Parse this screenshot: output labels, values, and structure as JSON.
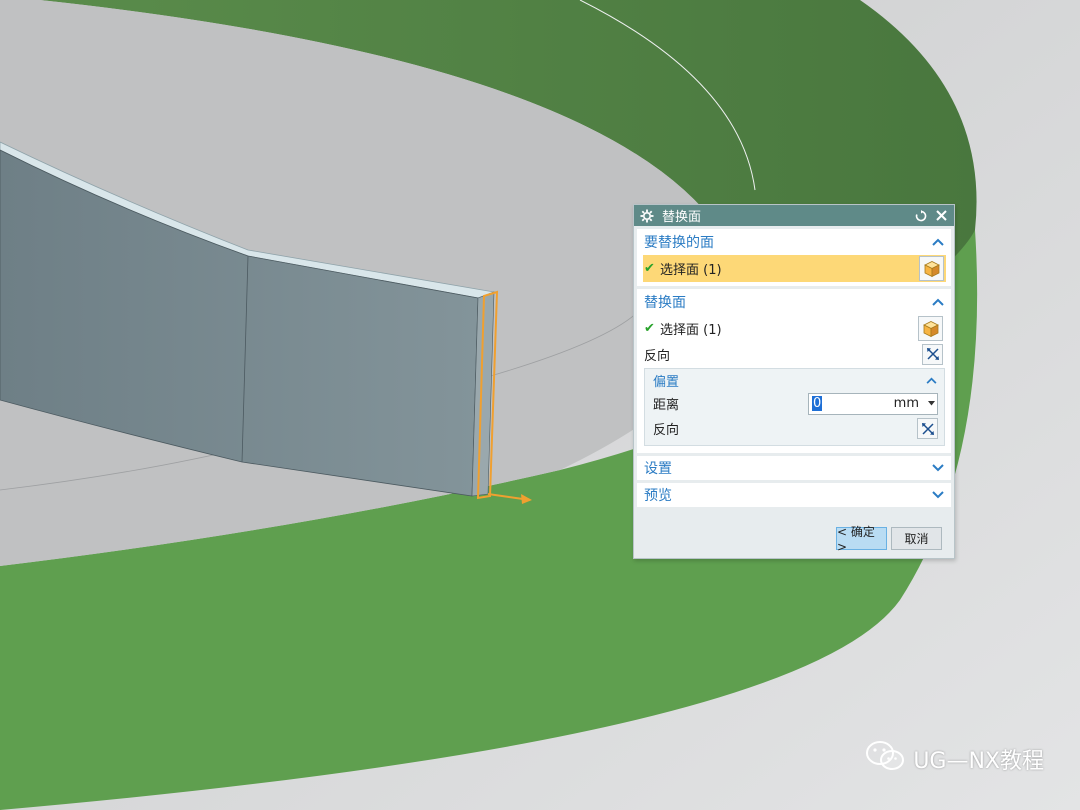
{
  "scene": {
    "colors": {
      "background": "#d9dadb",
      "inner_floor": "#c4c5c6",
      "green_band": "#5f9f4f",
      "green_wall": "#4f7f43",
      "part_face": "#7c8d93",
      "highlight": "#f0a030"
    }
  },
  "dialog": {
    "title": "替换面",
    "groups": {
      "face_to_replace": {
        "header": "要替换的面",
        "select_label": "选择面 (1)"
      },
      "replacement_face": {
        "header": "替换面",
        "select_label": "选择面 (1)",
        "reverse_label": "反向",
        "offset": {
          "header": "偏置",
          "distance_label": "距离",
          "distance_value": "0",
          "unit": "mm",
          "reverse_label": "反向"
        }
      },
      "settings": {
        "header": "设置"
      },
      "preview": {
        "header": "预览"
      }
    },
    "buttons": {
      "ok": "< 确定 >",
      "cancel": "取消"
    },
    "colors": {
      "titlebar": "#5f8a88",
      "header_text": "#2b7cc4",
      "active_row": "#fdd877",
      "check": "#29a32b"
    }
  },
  "watermark": {
    "text": "UG—NX教程"
  }
}
